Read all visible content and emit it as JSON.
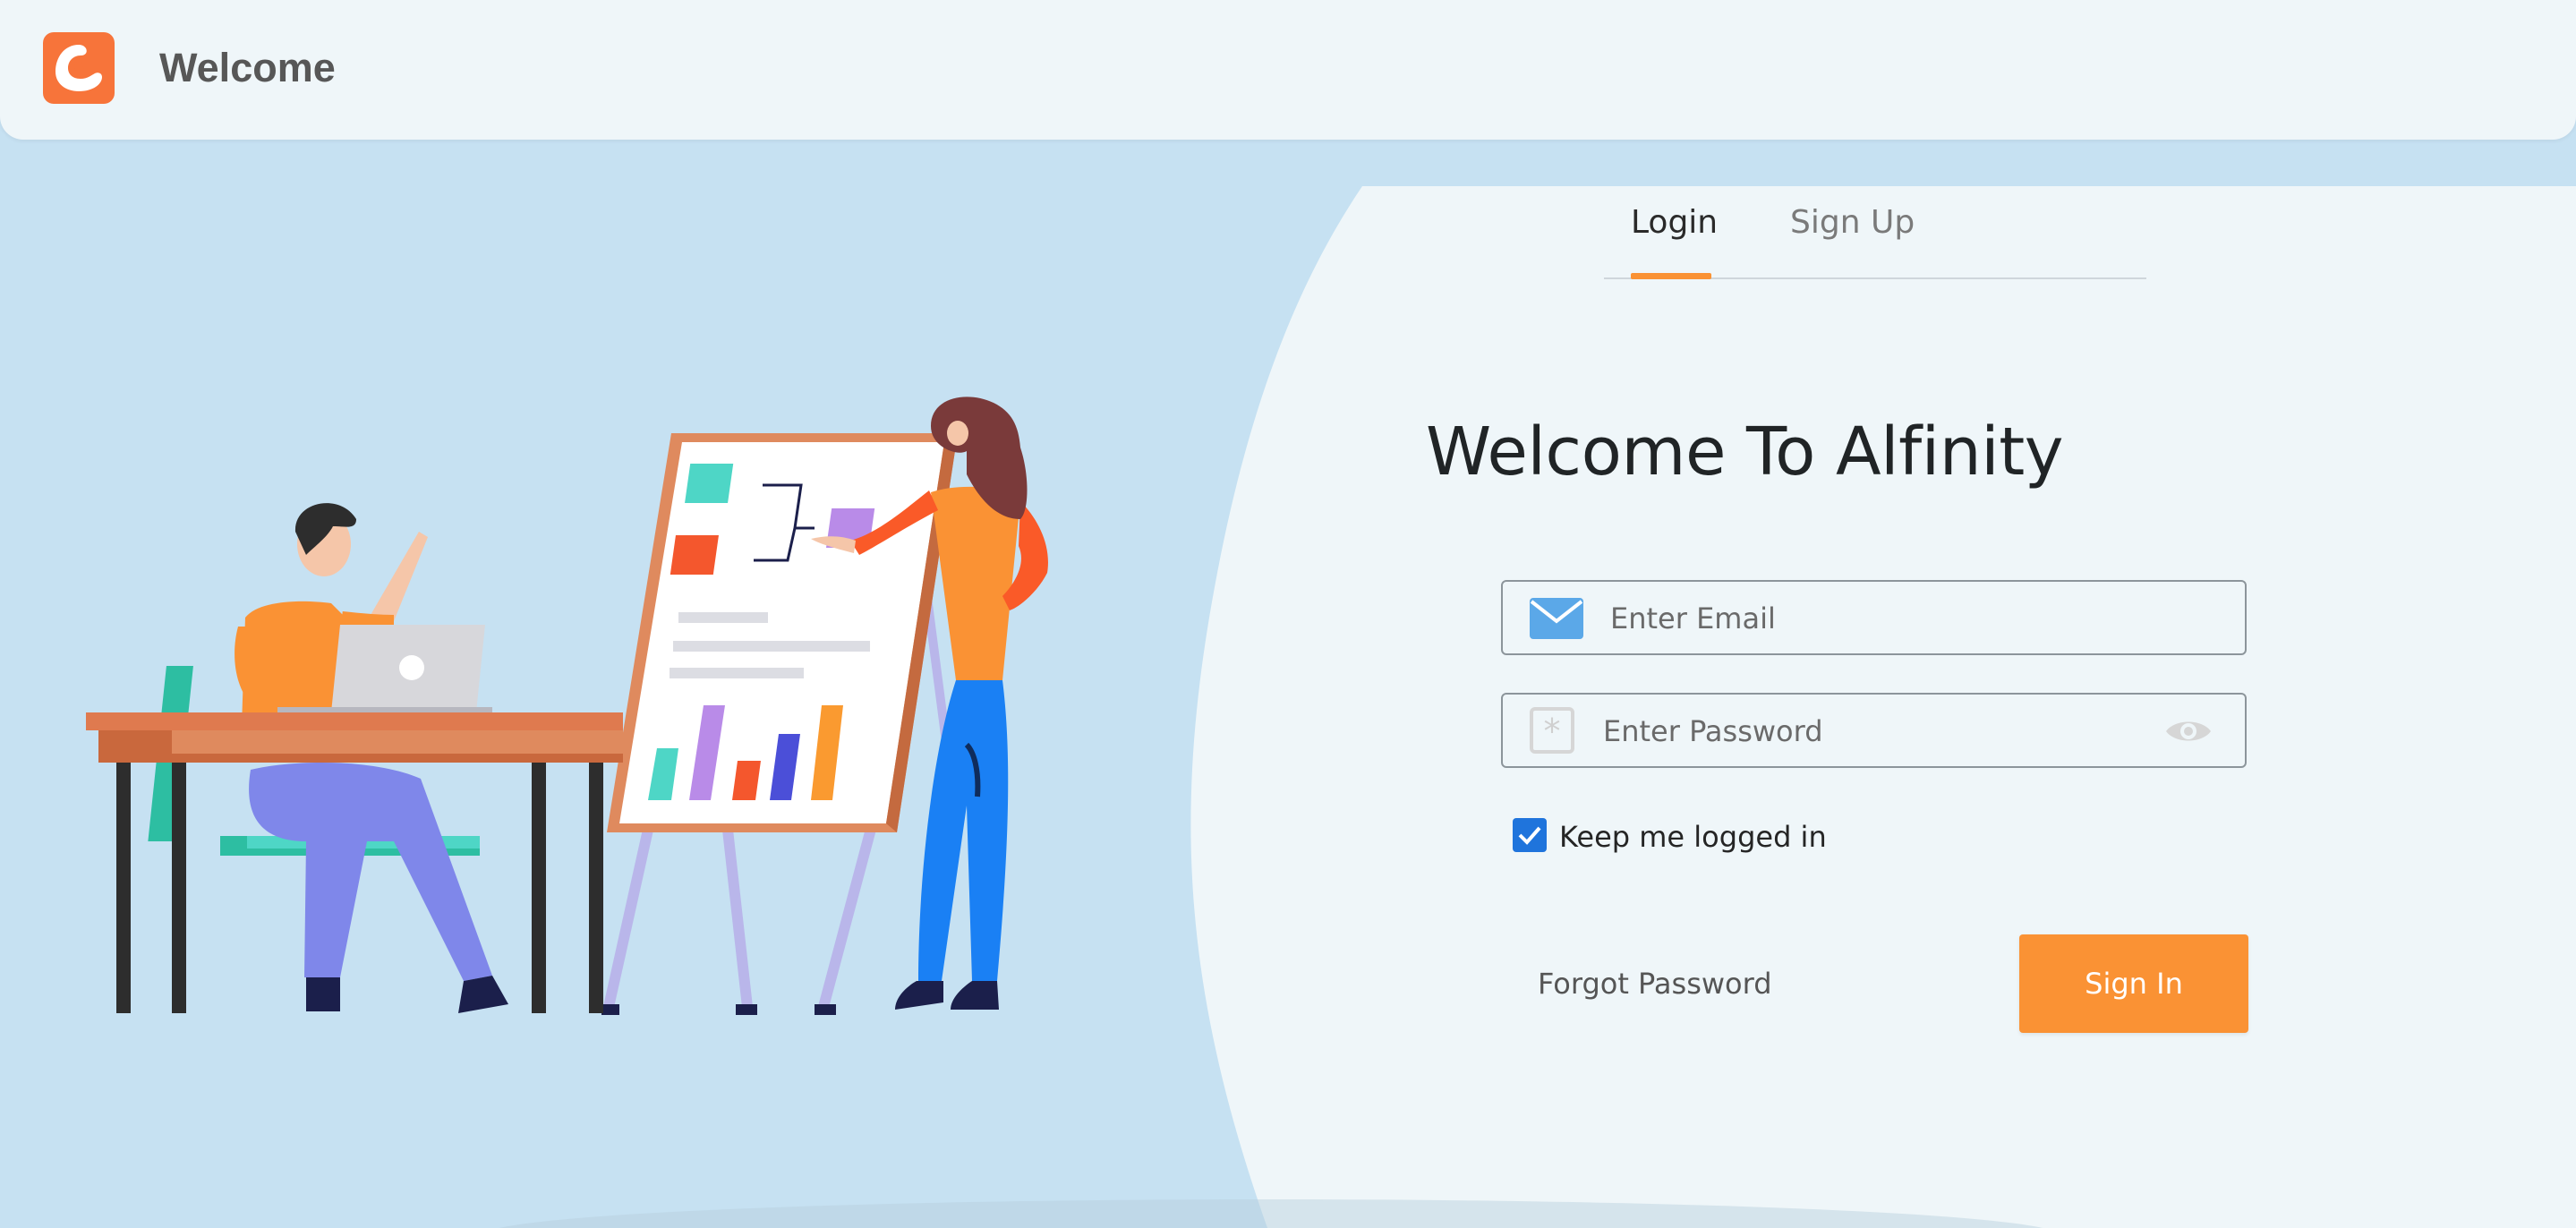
{
  "header": {
    "app_title": "Welcome",
    "logo_icon": "alfinity-logo-icon",
    "logo_color": "#f7743a"
  },
  "auth": {
    "tabs": [
      {
        "label": "Login",
        "active": true
      },
      {
        "label": "Sign Up",
        "active": false
      }
    ],
    "heading": "Welcome To Alfinity",
    "email": {
      "placeholder": "Enter Email",
      "value": "",
      "icon": "mail-icon"
    },
    "password": {
      "placeholder": "Enter Password",
      "value": "",
      "icon": "asterisk-icon",
      "toggle_icon": "eye-icon"
    },
    "keep_logged_in": {
      "label": "Keep me logged in",
      "checked": true
    },
    "forgot_label": "Forgot Password",
    "signin_label": "Sign In"
  },
  "colors": {
    "accent": "#fa9234",
    "background": "#c6e1f2",
    "panel": "#eff6f9",
    "checkbox": "#1f74dc"
  },
  "illustration": "team-presentation-illustration"
}
